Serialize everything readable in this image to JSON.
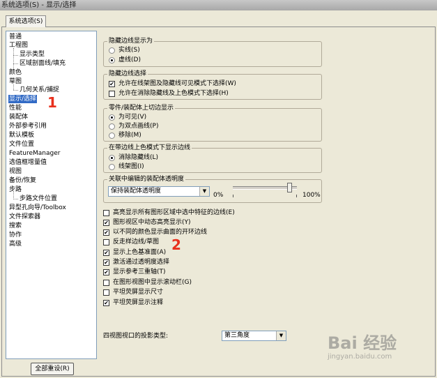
{
  "window": {
    "title": "系统选项(S) - 显示/选择"
  },
  "tab": {
    "label": "系统选项(S)"
  },
  "tree": {
    "items": [
      {
        "label": "普通"
      },
      {
        "label": "工程图"
      },
      {
        "label": "显示类型"
      },
      {
        "label": "区域剖面线/填充"
      },
      {
        "label": "颜色"
      },
      {
        "label": "草图"
      },
      {
        "label": "几何关系/捕捉"
      },
      {
        "label": "显示/选择"
      },
      {
        "label": "性能"
      },
      {
        "label": "装配体"
      },
      {
        "label": "外部参考引用"
      },
      {
        "label": "默认模板"
      },
      {
        "label": "文件位置"
      },
      {
        "label": "FeatureManager"
      },
      {
        "label": "选值框增量值"
      },
      {
        "label": "视图"
      },
      {
        "label": "备份/恢复"
      },
      {
        "label": "步路"
      },
      {
        "label": "步路文件位置"
      },
      {
        "label": "异型孔向导/Toolbox"
      },
      {
        "label": "文件探索器"
      },
      {
        "label": "搜索"
      },
      {
        "label": "协作"
      },
      {
        "label": "高级"
      }
    ]
  },
  "reset_button": {
    "label": "全部重设(R)"
  },
  "hidden_edges": {
    "title": "隐藏边线显示为",
    "options": [
      {
        "label": "实线(S)",
        "selected": false
      },
      {
        "label": "虚线(D)",
        "selected": true
      }
    ]
  },
  "hidden_select": {
    "title": "隐藏边线选择",
    "options": [
      {
        "label": "允许在线架图及隐藏线可见模式下选择(W)",
        "checked": true
      },
      {
        "label": "允许在消除隐藏线及上色模式下选择(H)",
        "checked": false
      }
    ]
  },
  "tangent": {
    "title": "零件/装配体上切边显示",
    "options": [
      {
        "label": "为可见(V)",
        "selected": true
      },
      {
        "label": "为双点画线(P)",
        "selected": false
      },
      {
        "label": "移除(M)",
        "selected": false
      }
    ]
  },
  "shaded_edges": {
    "title": "在带边线上色模式下显示边线",
    "options": [
      {
        "label": "消除隐藏线(L)",
        "selected": true
      },
      {
        "label": "线架图(I)",
        "selected": false
      }
    ]
  },
  "transparency": {
    "title": "关联中编辑的装配体透明度",
    "select_value": "保持装配体透明度",
    "min_label": "0%",
    "max_label": "100%",
    "level_percent": 88
  },
  "checks": [
    {
      "label": "高亮显示所有图形区域中选中特征的边线(E)",
      "checked": false
    },
    {
      "label": "图形视区中动态高亮显示(Y)",
      "checked": true
    },
    {
      "label": "以不同的颜色显示曲面的开环边线",
      "checked": true
    },
    {
      "label": "反走样边线/草图",
      "checked": false
    },
    {
      "label": "显示上色基准面(A)",
      "checked": true
    },
    {
      "label": "激活通过透明度选择",
      "checked": true
    },
    {
      "label": "显示参考三重轴(T)",
      "checked": true
    },
    {
      "label": "在图形视图中显示滚动栏(G)",
      "checked": false
    },
    {
      "label": "平坦荧屏显示尺寸",
      "checked": false
    },
    {
      "label": "平坦荧屏显示注释",
      "checked": true
    }
  ],
  "projection": {
    "label": "四视图视口的投影类型:",
    "value": "第三角度"
  },
  "annotations": {
    "one": "1",
    "two": "2"
  },
  "watermark": {
    "brand": "Bai 经验",
    "url": "jingyan.baidu.com"
  },
  "icons": {
    "check": "✔",
    "dropdown": "▼"
  }
}
